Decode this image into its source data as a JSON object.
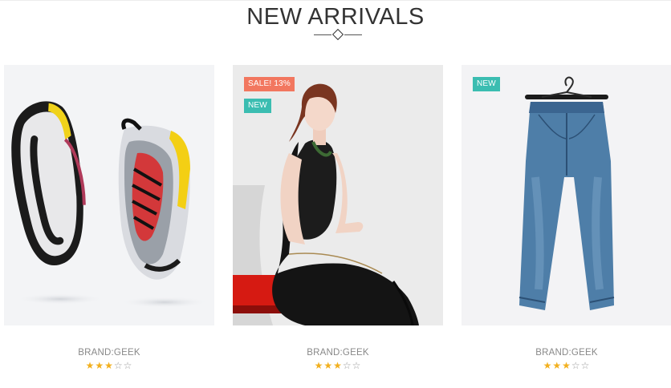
{
  "section": {
    "title": "NEW ARRIVALS"
  },
  "products": [
    {
      "image_icon": "sneakers-image",
      "badges": [],
      "brand": "BRAND:GEEK",
      "rating": 3,
      "rating_max": 5
    },
    {
      "image_icon": "woman-black-dress-image",
      "badges": [
        {
          "type": "sale",
          "label": "SALE! 13%"
        },
        {
          "type": "new",
          "label": "NEW"
        }
      ],
      "brand": "BRAND:GEEK",
      "rating": 3,
      "rating_max": 5
    },
    {
      "image_icon": "jeans-image",
      "badges": [
        {
          "type": "new",
          "label": "NEW"
        }
      ],
      "brand": "BRAND:GEEK",
      "rating": 3,
      "rating_max": 5
    }
  ],
  "colors": {
    "sale_badge": "#f2775f",
    "new_badge": "#3bbdb1",
    "star_filled": "#f2b01e",
    "star_empty": "#9a9a9a"
  }
}
